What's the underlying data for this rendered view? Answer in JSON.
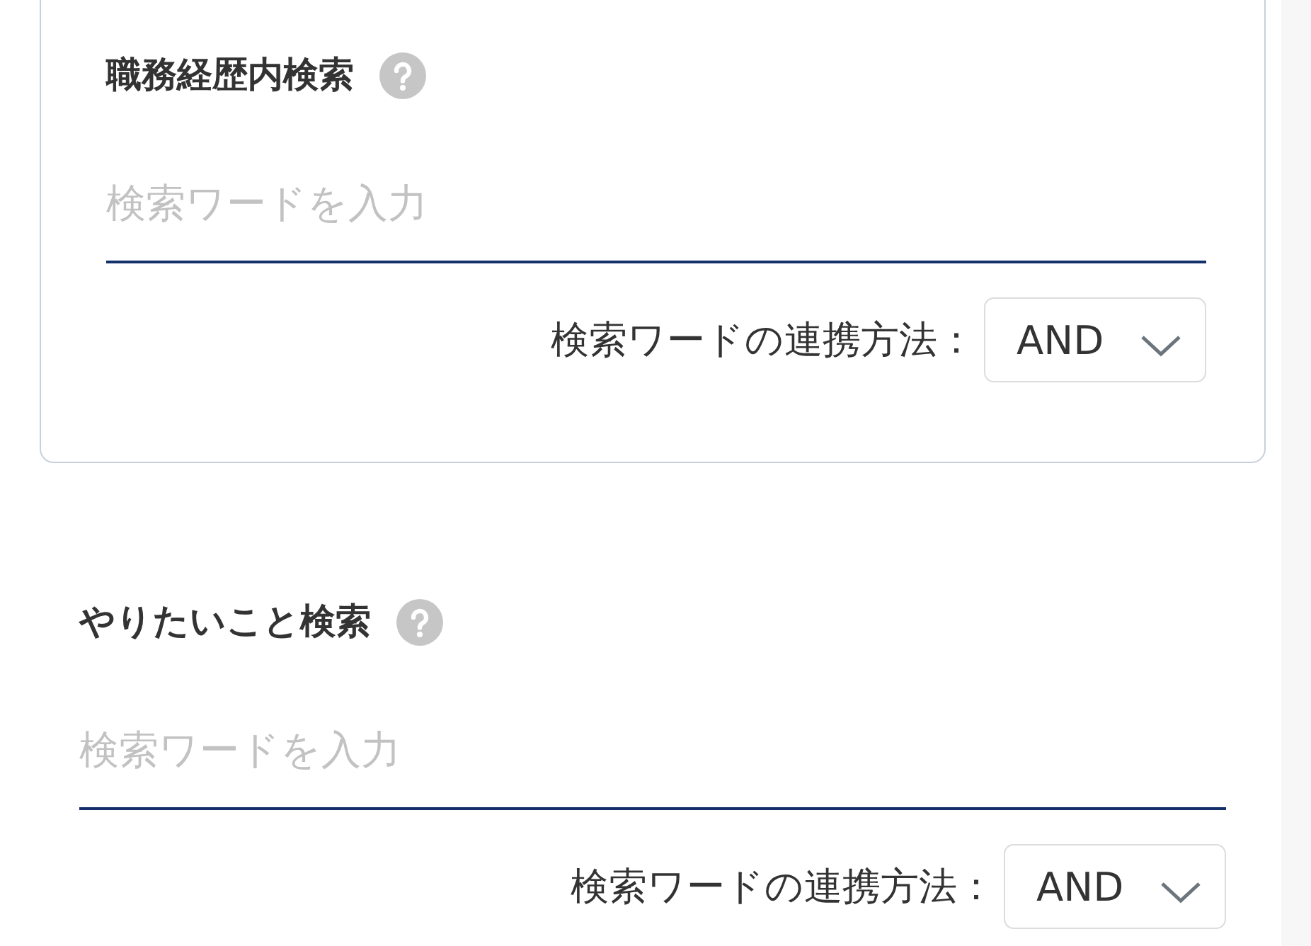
{
  "sections": [
    {
      "title": "職務経歴内検索",
      "boxed": true,
      "search": {
        "placeholder": "検索ワードを入力"
      },
      "link_label": "検索ワードの連携方法：",
      "link_mode": "AND"
    },
    {
      "title": "やりたいこと検索",
      "boxed": false,
      "search": {
        "placeholder": "検索ワードを入力"
      },
      "link_label": "検索ワードの連携方法：",
      "link_mode": "AND"
    }
  ]
}
